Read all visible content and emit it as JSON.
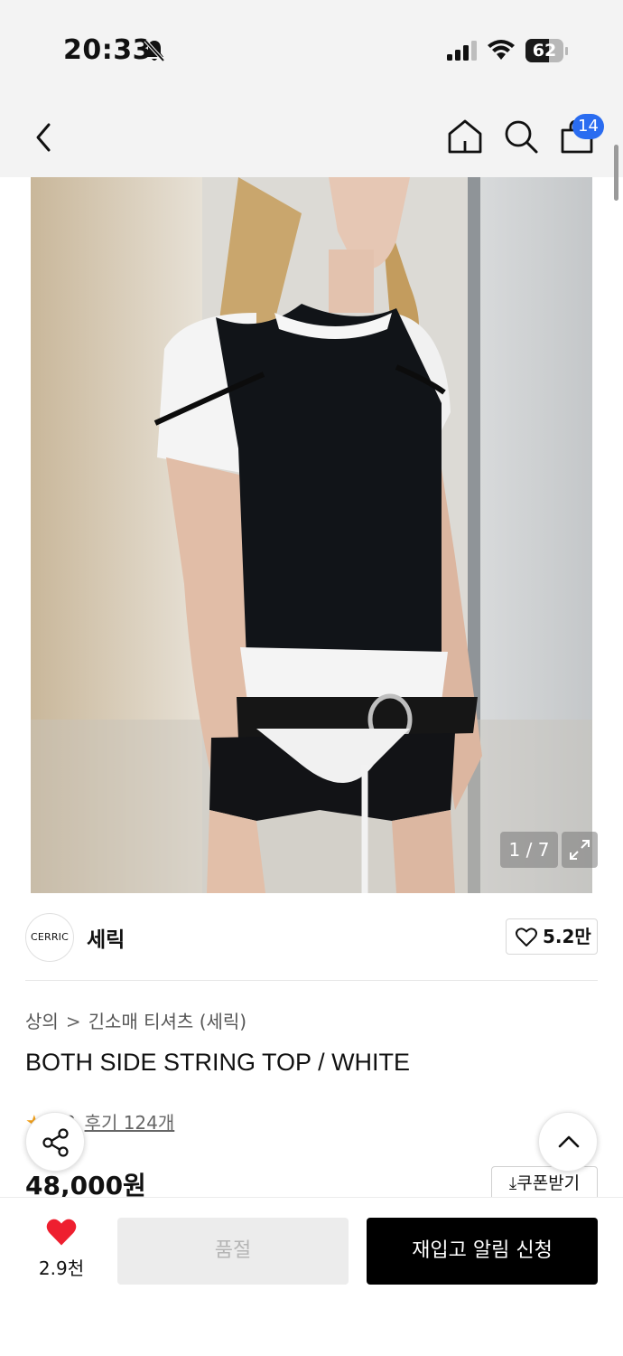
{
  "status_bar": {
    "time": "20:33",
    "battery_percent": 62,
    "battery_label": "62",
    "icons": [
      "bell-off-icon",
      "signal-icon",
      "wifi-icon",
      "battery-icon"
    ]
  },
  "header": {
    "icons": [
      "back-icon",
      "home-icon",
      "search-icon",
      "cart-icon"
    ],
    "cart_badge": "14"
  },
  "gallery": {
    "page_indicator": "1 / 7",
    "expand_icon": "expand-icon"
  },
  "brand": {
    "logo_text": "CERRIC",
    "name": "세릭",
    "like_count": "5.2만",
    "like_icon": "heart-outline-icon"
  },
  "product": {
    "breadcrumb": [
      "상의",
      "긴소매 티셔츠 (세릭)"
    ],
    "breadcrumb_separator": ">",
    "title": "BOTH SIDE STRING TOP / WHITE",
    "rating_icon": "star-icon",
    "rating_value": "4.8",
    "review_link": "후기 124개",
    "price": "48,000원",
    "coupon_label": "쿠폰받기",
    "coupon_icon": "download-icon"
  },
  "floating": {
    "share_icon": "share-icon",
    "top_icon": "chevron-up-icon"
  },
  "bottom_bar": {
    "like_icon": "heart-filled-icon",
    "like_count": "2.9천",
    "soldout_label": "품절",
    "restock_label": "재입고 알림 신청"
  },
  "colors": {
    "accent_badge": "#2a6cf0",
    "heart_red": "#ee1f2f",
    "star_orange": "#f2a01a",
    "primary_button": "#000000",
    "disabled_button": "#ececec"
  }
}
